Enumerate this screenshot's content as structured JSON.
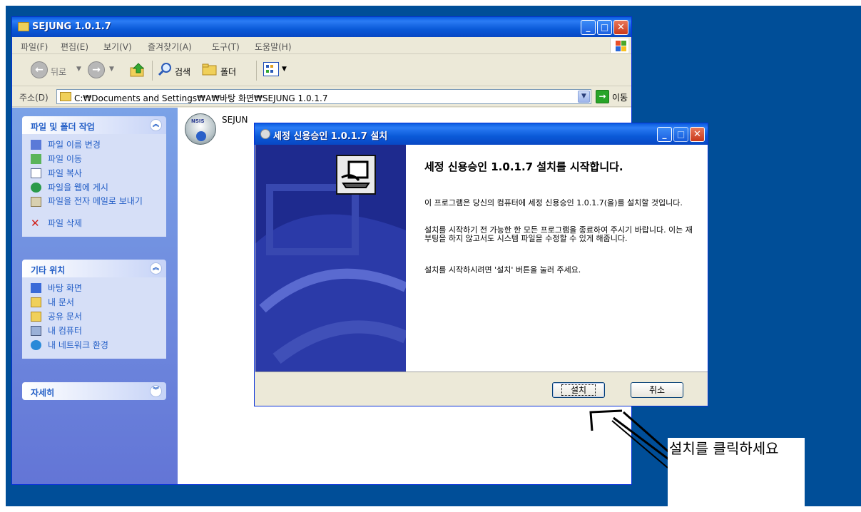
{
  "explorer": {
    "title": "SEJUNG 1.0.1.7",
    "menu": [
      "파일(F)",
      "편집(E)",
      "보기(V)",
      "즐겨찾기(A)",
      "도구(T)",
      "도움말(H)"
    ],
    "toolbar": {
      "back": "뒤로",
      "search": "검색",
      "folders": "폴더"
    },
    "address": {
      "label": "주소(D)",
      "value": "C:₩Documents and Settings₩A₩바탕 화면₩SEJUNG 1.0.1.7",
      "go": "이동"
    },
    "file_tasks": {
      "title": "파일 및 폴더 작업",
      "items": [
        "파일 이름 변경",
        "파일 이동",
        "파일 복사",
        "파일을 웹에 게시",
        "파일을 전자 메일로 보내기",
        "파일 삭제"
      ]
    },
    "other_places": {
      "title": "기타 위치",
      "items": [
        "바탕 화면",
        "내 문서",
        "공유 문서",
        "내 컴퓨터",
        "내 네트워크 환경"
      ]
    },
    "details": {
      "title": "자세히"
    },
    "file": {
      "label": "SEJUN",
      "icon_text": "NSIS"
    }
  },
  "installer": {
    "title": "세정 신용승인 1.0.1.7 설치",
    "heading": "세정 신용승인 1.0.1.7 설치를 시작합니다.",
    "para1": "이 프로그램은 당신의 컴퓨터에 세정 신용승인 1.0.1.7(을)를 설치할 것입니다.",
    "para2": "설치를 시작하기 전 가능한 한 모든 프로그램을 종료하여 주시기 바랍니다. 이는 재부팅을 하지 않고서도 시스템 파일을 수정할 수 있게 해줍니다.",
    "para3": "설치를 시작하시려면 '설치' 버튼을 눌러 주세요.",
    "install_button": "설치",
    "cancel_button": "취소"
  },
  "annotation": {
    "text": "설치를 클릭하세요"
  },
  "colors": {
    "desktop": "#004e98",
    "titlebar": "#0a5ce0",
    "sidebar": "#7ba2e7",
    "link": "#215dc6"
  }
}
